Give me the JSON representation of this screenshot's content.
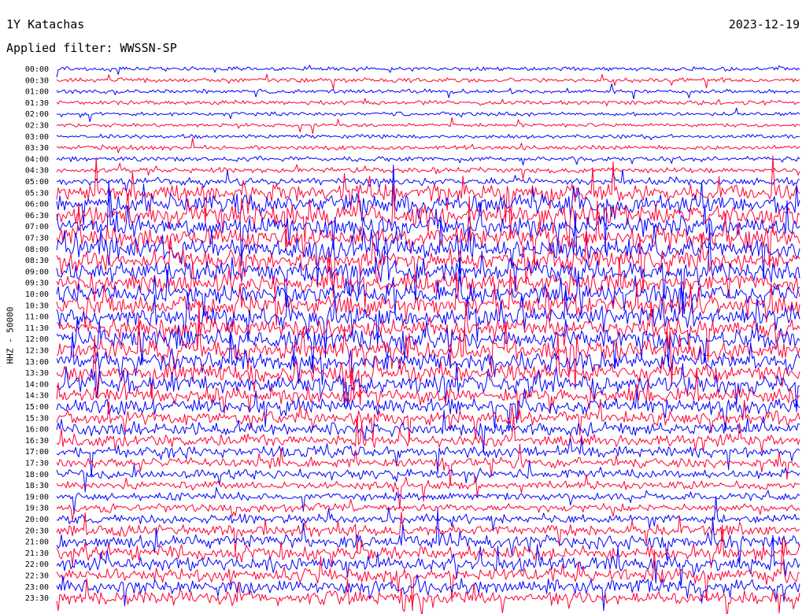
{
  "header": {
    "station": "1Y Katachas",
    "date": "2023-12-19",
    "filter": "Applied filter: WWSSN-SP"
  },
  "chart_data": {
    "type": "line",
    "title": "1Y Katachas",
    "channel_label": "HHZ - 50000",
    "row_interval_minutes": 30,
    "trace_colors": [
      "#0000ff",
      "#ff0033"
    ],
    "x_range_minutes": [
      0,
      30
    ],
    "rows": [
      "00:00",
      "00:30",
      "01:00",
      "01:30",
      "02:00",
      "02:30",
      "03:00",
      "03:30",
      "04:00",
      "04:30",
      "05:00",
      "05:30",
      "06:00",
      "06:30",
      "07:00",
      "07:30",
      "08:00",
      "08:30",
      "09:00",
      "09:30",
      "10:00",
      "10:30",
      "11:00",
      "11:30",
      "12:00",
      "12:30",
      "13:00",
      "13:30",
      "14:00",
      "14:30",
      "15:00",
      "15:30",
      "16:00",
      "16:30",
      "17:00",
      "17:30",
      "18:00",
      "18:30",
      "19:00",
      "19:30",
      "20:00",
      "20:30",
      "21:00",
      "21:30",
      "22:00",
      "22:30",
      "23:00",
      "23:30"
    ],
    "relative_activity": [
      0.1,
      0.12,
      0.1,
      0.11,
      0.08,
      0.08,
      0.1,
      0.12,
      0.14,
      0.16,
      0.3,
      0.75,
      0.85,
      0.85,
      0.9,
      0.9,
      0.9,
      0.9,
      0.9,
      0.85,
      0.85,
      0.85,
      0.85,
      0.85,
      0.85,
      0.85,
      0.8,
      0.8,
      0.75,
      0.7,
      0.65,
      0.6,
      0.55,
      0.5,
      0.45,
      0.4,
      0.35,
      0.3,
      0.3,
      0.3,
      0.35,
      0.45,
      0.55,
      0.6,
      0.6,
      0.6,
      0.6,
      0.6
    ]
  }
}
